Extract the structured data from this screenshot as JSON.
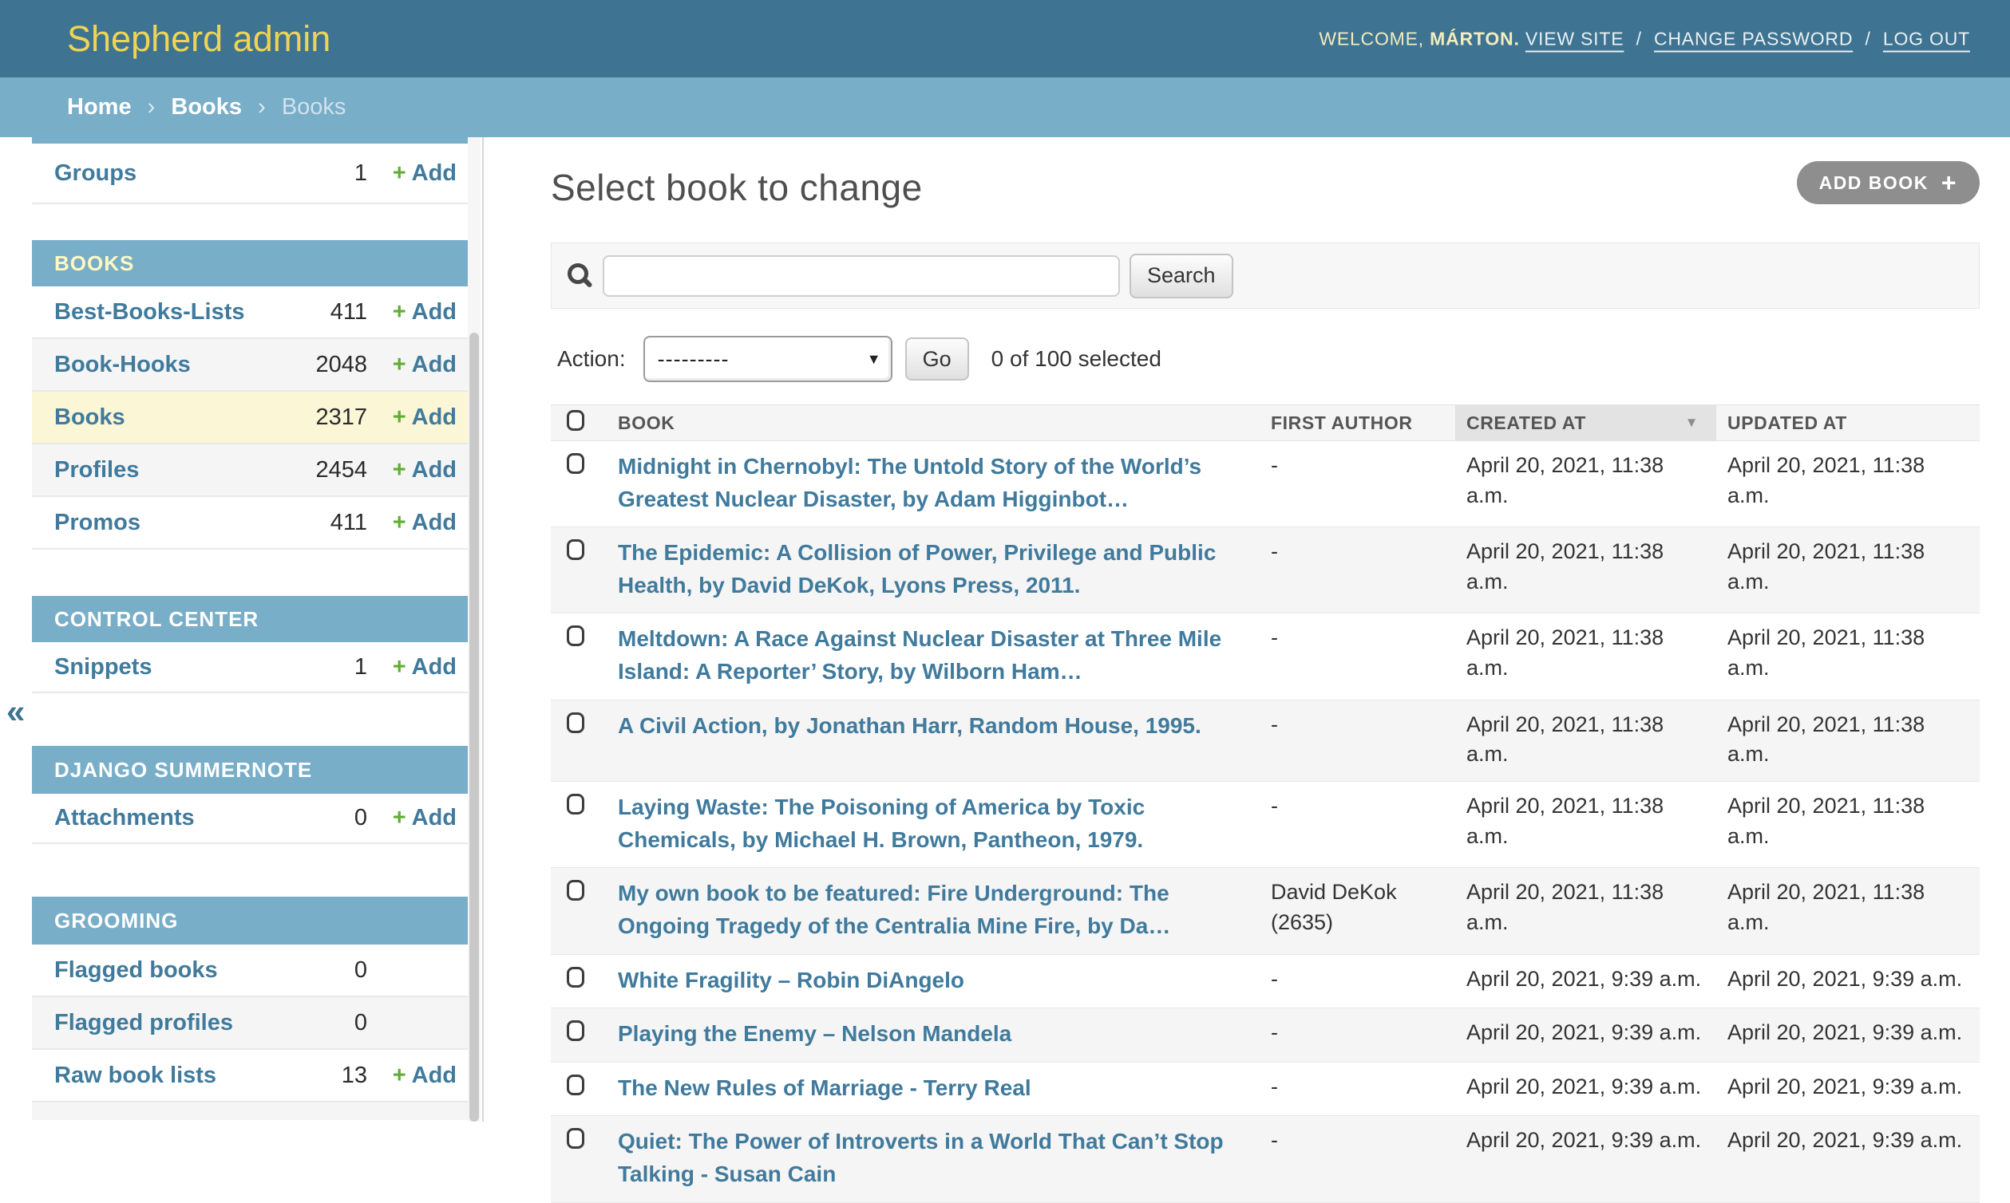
{
  "colors": {
    "header_bg": "#3e7491",
    "brand_yellow": "#efd453",
    "breadcrumb_bg": "#79aec8",
    "module_header_bg": "#79aec8",
    "link_accent": "#407a9c",
    "add_green": "#5fae30",
    "selected_row_bg": "#fbf6d5",
    "stripe_bg": "#f5f5f5",
    "object_tools_bg": "#8e8e8e"
  },
  "icons": {
    "plus": "+",
    "caret_down": "▼",
    "sort_desc": "▼",
    "collapse": "«"
  },
  "branding": {
    "title": "Shepherd admin"
  },
  "user_tools": {
    "welcome": "WELCOME,",
    "username": "MÁRTON.",
    "sep": "/",
    "links": [
      "VIEW SITE",
      "CHANGE PASSWORD",
      "LOG OUT"
    ]
  },
  "breadcrumbs": {
    "sep": "›",
    "links": [
      "Home",
      "Books"
    ],
    "current": "Books"
  },
  "sidebar": {
    "collapse_glyph": "«",
    "add_label": "Add",
    "orphan_items": [
      {
        "label": "Groups",
        "count": "1"
      }
    ],
    "sections": [
      {
        "title": "BOOKS",
        "items": [
          {
            "label": "Best-Books-Lists",
            "count": "411"
          },
          {
            "label": "Book-Hooks",
            "count": "2048"
          },
          {
            "label": "Books",
            "count": "2317"
          },
          {
            "label": "Profiles",
            "count": "2454"
          },
          {
            "label": "Promos",
            "count": "411"
          }
        ]
      },
      {
        "title": "CONTROL CENTER",
        "items": [
          {
            "label": "Snippets",
            "count": "1"
          }
        ]
      },
      {
        "title": "DJANGO SUMMERNOTE",
        "items": [
          {
            "label": "Attachments",
            "count": "0"
          }
        ]
      },
      {
        "title": "GROOMING",
        "items": [
          {
            "label": "Flagged books",
            "count": "0"
          },
          {
            "label": "Flagged profiles",
            "count": "0"
          },
          {
            "label": "Raw book lists",
            "count": "13"
          }
        ]
      }
    ]
  },
  "main": {
    "title": "Select book to change",
    "add_button_label": "ADD BOOK",
    "search_button_label": "Search",
    "action_label": "Action:",
    "action_value": "---------",
    "go_label": "Go",
    "selection_status": "0 of 100 selected",
    "table": {
      "headers": [
        "BOOK",
        "FIRST AUTHOR",
        "CREATED AT",
        "UPDATED AT"
      ],
      "sorted_column": "CREATED AT",
      "sort_direction": "descending",
      "rows": [
        {
          "book": "Midnight in Chernobyl: The Untold Story of the World’s Greatest Nuclear Disaster, by Adam Higginbot…",
          "first_author": "-",
          "created_at": "April 20, 2021, 11:38 a.m.",
          "updated_at": "April 20, 2021, 11:38 a.m."
        },
        {
          "book": "The Epidemic: A Collision of Power, Privilege and Public Health, by David DeKok, Lyons Press, 2011.",
          "first_author": "-",
          "created_at": "April 20, 2021, 11:38 a.m.",
          "updated_at": "April 20, 2021, 11:38 a.m."
        },
        {
          "book": "Meltdown: A Race Against Nuclear Disaster at Three Mile Island: A Reporter’ Story, by Wilborn Ham…",
          "first_author": "-",
          "created_at": "April 20, 2021, 11:38 a.m.",
          "updated_at": "April 20, 2021, 11:38 a.m."
        },
        {
          "book": "A Civil Action, by Jonathan Harr, Random House, 1995.",
          "first_author": "-",
          "created_at": "April 20, 2021, 11:38 a.m.",
          "updated_at": "April 20, 2021, 11:38 a.m."
        },
        {
          "book": "Laying Waste: The Poisoning of America by Toxic Chemicals, by Michael H. Brown, Pantheon, 1979.",
          "first_author": "-",
          "created_at": "April 20, 2021, 11:38 a.m.",
          "updated_at": "April 20, 2021, 11:38 a.m."
        },
        {
          "book": "My own book to be featured: Fire Underground: The Ongoing Tragedy of the Centralia Mine Fire, by Da…",
          "first_author": "David DeKok (2635)",
          "created_at": "April 20, 2021, 11:38 a.m.",
          "updated_at": "April 20, 2021, 11:38 a.m."
        },
        {
          "book": "White Fragility – Robin DiAngelo",
          "first_author": "-",
          "created_at": "April 20, 2021, 9:39 a.m.",
          "updated_at": "April 20, 2021, 9:39 a.m."
        },
        {
          "book": "Playing the Enemy – Nelson Mandela",
          "first_author": "-",
          "created_at": "April 20, 2021, 9:39 a.m.",
          "updated_at": "April 20, 2021, 9:39 a.m."
        },
        {
          "book": "The New Rules of Marriage - Terry Real",
          "first_author": "-",
          "created_at": "April 20, 2021, 9:39 a.m.",
          "updated_at": "April 20, 2021, 9:39 a.m."
        },
        {
          "book": "Quiet: The Power of Introverts in a World That Can’t Stop Talking - Susan Cain",
          "first_author": "-",
          "created_at": "April 20, 2021, 9:39 a.m.",
          "updated_at": "April 20, 2021, 9:39 a.m."
        }
      ]
    }
  }
}
